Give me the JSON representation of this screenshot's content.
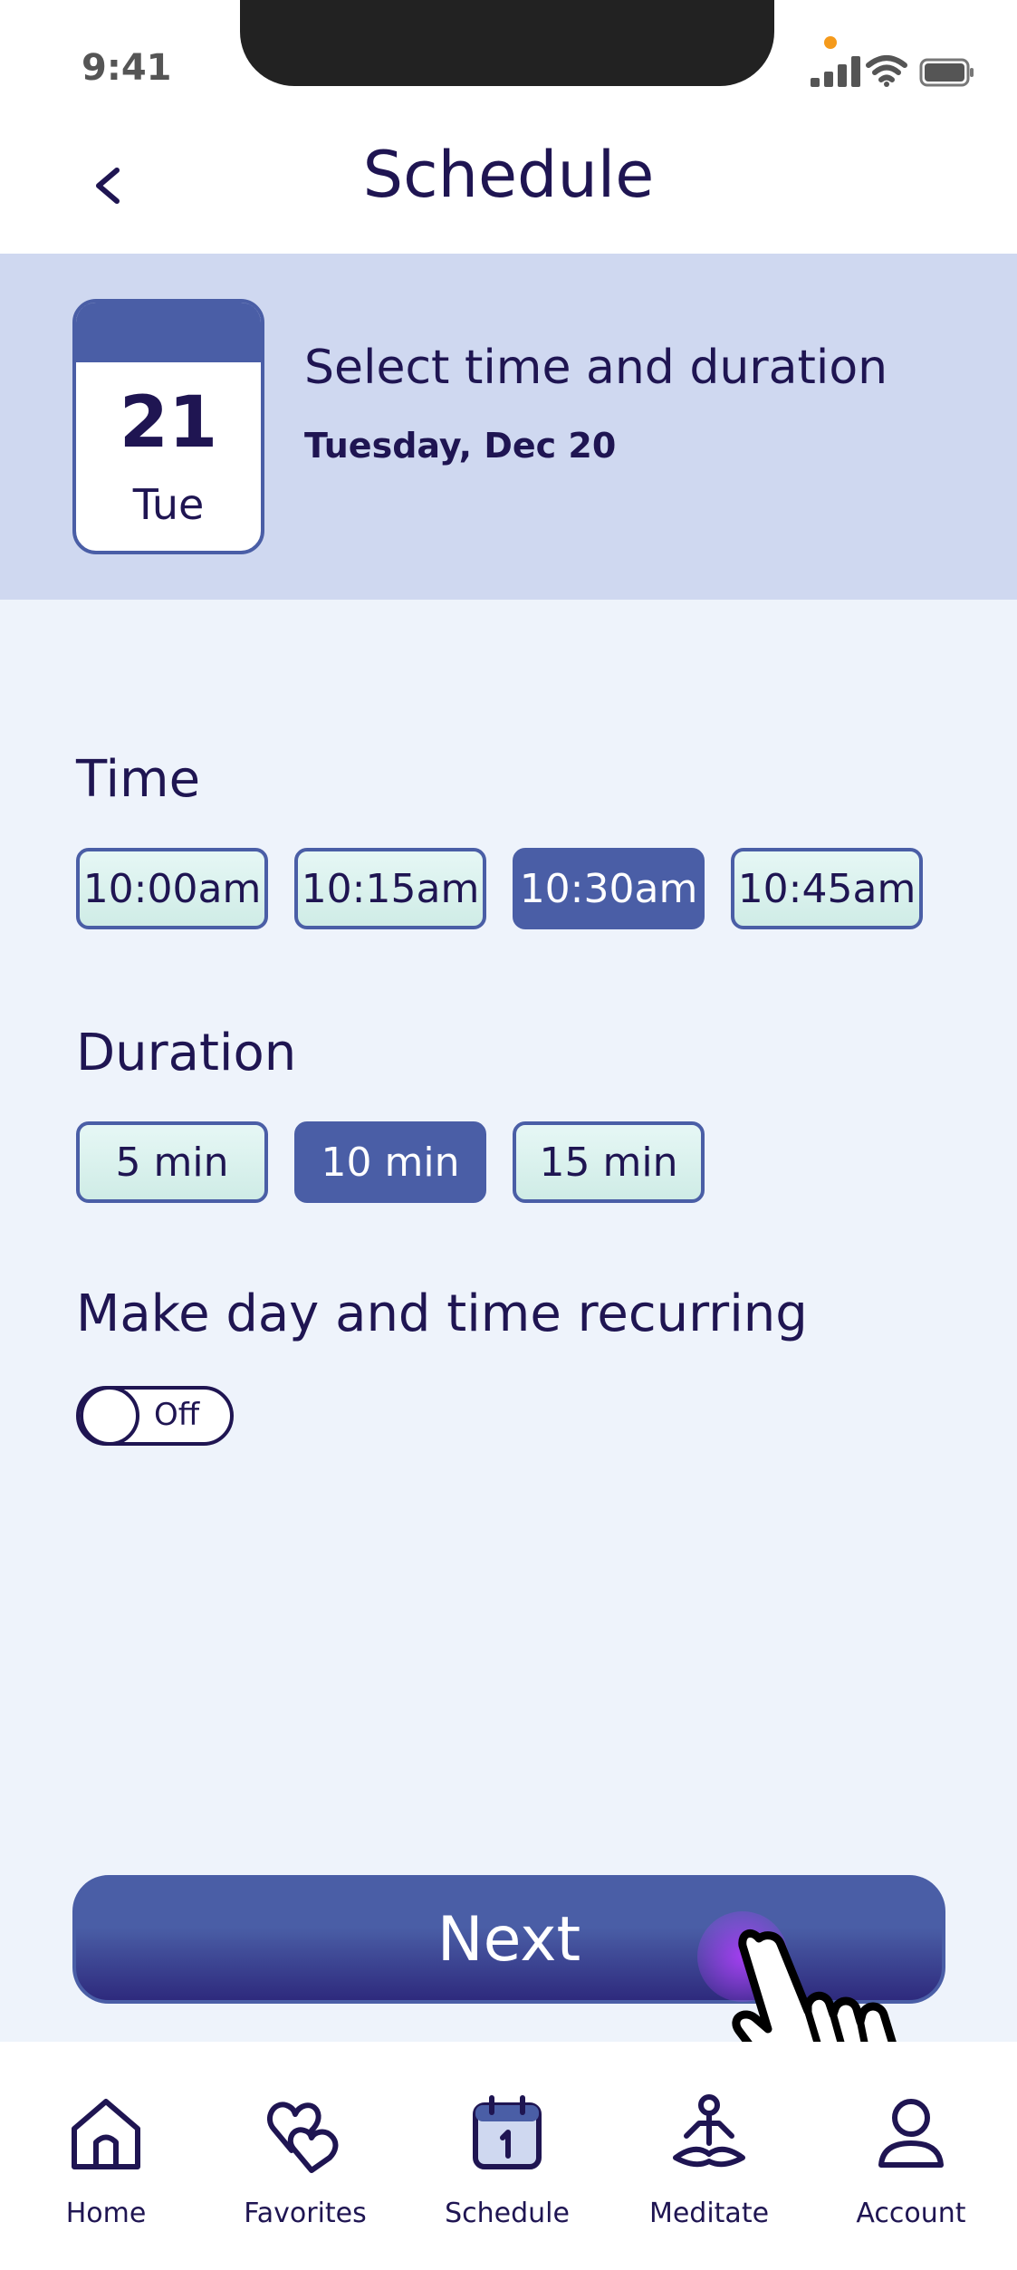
{
  "status_bar": {
    "time": "9:41"
  },
  "header": {
    "title": "Schedule"
  },
  "banner": {
    "day_number": "21",
    "day_short": "Tue",
    "title": "Select time and duration",
    "subtitle": "Tuesday, Dec 20"
  },
  "time_section": {
    "label": "Time",
    "options": [
      "10:00am",
      "10:15am",
      "10:30am",
      "10:45am"
    ],
    "selected": "10:30am"
  },
  "duration_section": {
    "label": "Duration",
    "options": [
      "5 min",
      "10 min",
      "15 min"
    ],
    "selected": "10 min"
  },
  "recurring": {
    "label": "Make day and time recurring",
    "state": "Off"
  },
  "next_button": {
    "label": "Next"
  },
  "tab_bar": {
    "items": [
      {
        "label": "Home",
        "icon": "home-icon"
      },
      {
        "label": "Favorites",
        "icon": "hearts-icon"
      },
      {
        "label": "Schedule",
        "icon": "calendar-icon"
      },
      {
        "label": "Meditate",
        "icon": "meditate-icon"
      },
      {
        "label": "Account",
        "icon": "account-icon"
      }
    ]
  },
  "colors": {
    "primary": "#4a5ea6",
    "text": "#1f1552",
    "banner": "#cfd8f0",
    "background": "#eef3fb",
    "chip_fill": "#dff3ef"
  }
}
